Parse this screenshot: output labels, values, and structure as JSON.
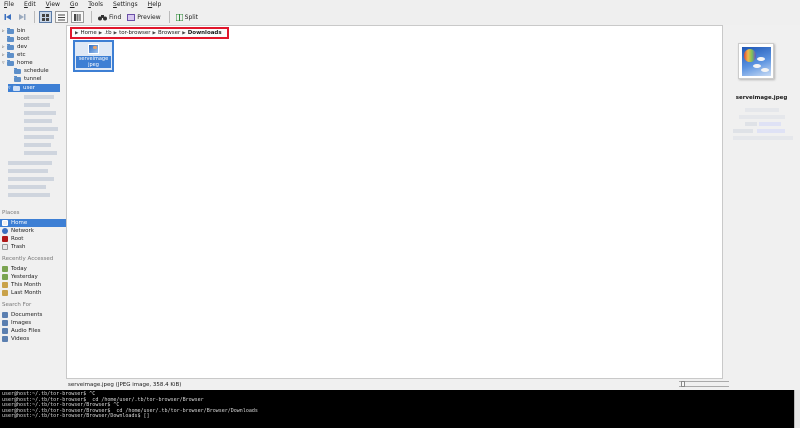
{
  "menu": [
    "File",
    "Edit",
    "View",
    "Go",
    "Tools",
    "Settings",
    "Help"
  ],
  "toolbar": {
    "find": "Find",
    "preview": "Preview",
    "split": "Split"
  },
  "tree": {
    "items": [
      {
        "label": "bin",
        "expander": "▹"
      },
      {
        "label": "boot",
        "expander": ""
      },
      {
        "label": "dev",
        "expander": "▹"
      },
      {
        "label": "etc",
        "expander": "▹"
      },
      {
        "label": "home",
        "expander": "▿"
      },
      {
        "label": "schedule",
        "expander": ""
      },
      {
        "label": "tunnel",
        "expander": ""
      },
      {
        "label": "user",
        "expander": "▿"
      }
    ]
  },
  "places": {
    "heading": "Places",
    "items": [
      {
        "label": "Home",
        "icon": "home-icon"
      },
      {
        "label": "Network",
        "icon": "network-icon"
      },
      {
        "label": "Root",
        "icon": "root-icon"
      },
      {
        "label": "Trash",
        "icon": "trash-icon"
      }
    ]
  },
  "recent": {
    "heading": "Recently Accessed",
    "items": [
      {
        "label": "Today"
      },
      {
        "label": "Yesterday"
      },
      {
        "label": "This Month"
      },
      {
        "label": "Last Month"
      }
    ]
  },
  "search": {
    "heading": "Search For",
    "items": [
      {
        "label": "Documents"
      },
      {
        "label": "Images"
      },
      {
        "label": "Audio Files"
      },
      {
        "label": "Videos"
      }
    ]
  },
  "breadcrumb": [
    "Home",
    ".tb",
    "tor-browser",
    "Browser",
    "Downloads"
  ],
  "file": {
    "name_line1": "serveimage",
    "name_line2": "jpeg"
  },
  "preview": {
    "filename": "serveimage.jpeg"
  },
  "status": {
    "text": "serveimage.jpeg (JPEG image, 358.4 KiB)"
  },
  "terminal": {
    "lines": [
      "user@host:~/.tb/tor-browser$ ^C",
      "user@host:~/.tb/tor-browser$  cd /home/user/.tb/tor-browser/Browser",
      "user@host:~/.tb/tor-browser/Browser$ ^C",
      "user@host:~/.tb/tor-browser/Browser$  cd /home/user/.tb/tor-browser/Browser/Downloads",
      "user@host:~/.tb/tor-browser/Browser/Downloads$ []"
    ]
  },
  "colors": {
    "selection": "#3d7fd4",
    "highlight_box": "#e0162b",
    "terminal_bg": "#000000"
  }
}
